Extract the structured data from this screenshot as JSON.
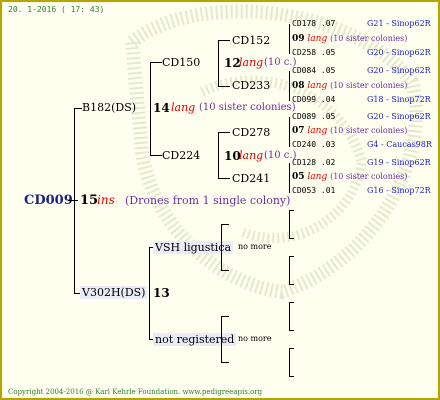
{
  "date": "20. 1-2016 ( 17: 43)",
  "footer": "Copyright 2004-2016 @ Karl Kehrle Foundation.   www.pedigreeapis.org",
  "root": {
    "id": "CD009",
    "num": "15",
    "ins": "ins",
    "desc": "(Drones from 1 single colony)"
  },
  "b182": {
    "label": "B182(DS)",
    "num": "14",
    "lang": "lang",
    "desc": "(10 sister colonies)"
  },
  "cd150": {
    "label": "CD150",
    "num": "12",
    "lang": "lang",
    "desc": "(10 c.)"
  },
  "cd224": {
    "label": "CD224",
    "num": "10",
    "lang": "lang",
    "desc": "(10 c.)"
  },
  "cd152": "CD152",
  "cd233": "CD233",
  "cd278": "CD278",
  "cd241": "CD241",
  "leaves": [
    {
      "id": "CD178",
      "gen": ".07",
      "source": "G21 - Sinop62R"
    },
    {
      "num": "09",
      "lang": "lang",
      "desc": "(10 sister colonies)"
    },
    {
      "id": "CD258",
      "gen": ".05",
      "source": "G20 - Sinop62R"
    },
    {
      "id": "CD084",
      "gen": ".05",
      "source": "G20 - Sinop62R"
    },
    {
      "num": "08",
      "lang": "lang",
      "desc": "(10 sister colonies)"
    },
    {
      "id": "CD099",
      "gen": ".04",
      "source": "G18 - Sinop72R"
    },
    {
      "id": "CD089",
      "gen": ".05",
      "source": "G20 - Sinop62R"
    },
    {
      "num": "07",
      "lang": "lang",
      "desc": "(10 sister colonies)"
    },
    {
      "id": "CD240",
      "gen": ".03",
      "source": "G4 - Caucas98R"
    },
    {
      "id": "CD128",
      "gen": ".02",
      "source": "G19 - Sinop62R"
    },
    {
      "num": "05",
      "lang": "lang",
      "desc": "(10 sister colonies)"
    },
    {
      "id": "CD053",
      "gen": ".01",
      "source": "G16 - Sinop72R"
    }
  ],
  "v302": {
    "label": "V302H(DS)",
    "num": "13"
  },
  "vsh": {
    "label": "VSH ligustica",
    "more": "no more"
  },
  "notreg": {
    "label": "not registered",
    "more": "no more"
  },
  "colors": {
    "border": "#b8a400",
    "footer": "#2e7d32",
    "red": "#e00000",
    "purple": "#6b2fa0",
    "blue": "#1a1acc"
  }
}
